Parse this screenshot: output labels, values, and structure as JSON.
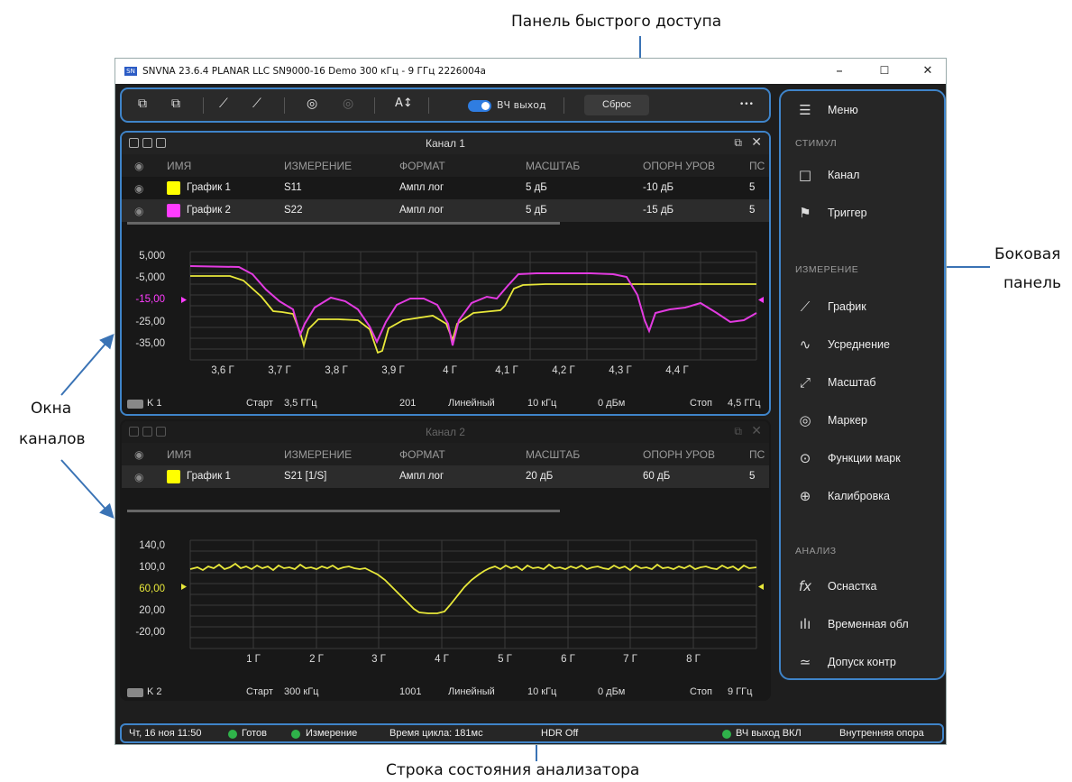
{
  "annotations": {
    "quick_panel": "Панель быстрого доступа",
    "side_panel_line1": "Боковая",
    "side_panel_line2": "панель",
    "channel_windows_line1": "Окна",
    "channel_windows_line2": "каналов",
    "status_bar": "Строка состояния анализатора"
  },
  "window": {
    "logo": "SN",
    "title": "SNVNA 23.6.4  PLANAR LLC SN9000-16 Demo 300 кГц - 9 ГГц 2226004a",
    "minimize": "–",
    "maximize": "☐",
    "close": "✕"
  },
  "quick_panel": {
    "rf_output_label": "ВЧ выход",
    "reset_label": "Сброс",
    "more": "•••",
    "autoscale": "A↕"
  },
  "channel1": {
    "title": "Канал 1",
    "headers": [
      "ИМЯ",
      "ИЗМЕРЕНИЕ",
      "ФОРМАТ",
      "МАСШТАБ",
      "ОПОРН УРОВ",
      "ПС"
    ],
    "rows": [
      {
        "name": "График 1",
        "meas": "S11",
        "format": "Ампл лог",
        "scale": "5 дБ",
        "ref": "-10 дБ",
        "pos": "5",
        "color": "#ffff00"
      },
      {
        "name": "График 2",
        "meas": "S22",
        "format": "Ампл лог",
        "scale": "5 дБ",
        "ref": "-15 дБ",
        "pos": "5",
        "color": "#ff3cff"
      }
    ],
    "y_ticks": [
      "5,000",
      "-5,000",
      "-15,00",
      "-25,00",
      "-35,00"
    ],
    "x_ticks": [
      "3,6 Г",
      "3,7 Г",
      "3,8 Г",
      "3,9 Г",
      "4 Г",
      "4,1 Г",
      "4,2 Г",
      "4,3 Г",
      "4,4 Г"
    ],
    "status": {
      "k": "K 1",
      "start_label": "Старт",
      "start": "3,5 ГГц",
      "points": "201",
      "sweep": "Линейный",
      "ifbw": "10 кГц",
      "power": "0 дБм",
      "stop_label": "Стоп",
      "stop": "4,5 ГГц"
    }
  },
  "channel2": {
    "title": "Канал 2",
    "headers": [
      "ИМЯ",
      "ИЗМЕРЕНИЕ",
      "ФОРМАТ",
      "МАСШТАБ",
      "ОПОРН УРОВ",
      "ПС"
    ],
    "rows": [
      {
        "name": "График 1",
        "meas": "S21 [1/S]",
        "format": "Ампл лог",
        "scale": "20 дБ",
        "ref": "60 дБ",
        "pos": "5",
        "color": "#ffff00"
      }
    ],
    "y_ticks": [
      "140,0",
      "100,0",
      "60,00",
      "20,00",
      "-20,00"
    ],
    "x_ticks": [
      "1 Г",
      "2 Г",
      "3 Г",
      "4 Г",
      "5 Г",
      "6 Г",
      "7 Г",
      "8 Г"
    ],
    "status": {
      "k": "K 2",
      "start_label": "Старт",
      "start": "300 кГц",
      "points": "1001",
      "sweep": "Линейный",
      "ifbw": "10 кГц",
      "power": "0 дБм",
      "stop_label": "Стоп",
      "stop": "9 ГГц"
    }
  },
  "side_panel": {
    "menu": "Меню",
    "sections": [
      {
        "title": "СТИМУЛ",
        "items": [
          {
            "label": "Канал",
            "icon": "□"
          },
          {
            "label": "Триггер",
            "icon": "⚑"
          }
        ]
      },
      {
        "title": "ИЗМЕРЕНИЕ",
        "items": [
          {
            "label": "График",
            "icon": "📈"
          },
          {
            "label": "Усреднение",
            "icon": "∿"
          },
          {
            "label": "Масштаб",
            "icon": "⤢"
          },
          {
            "label": "Маркер",
            "icon": "◎"
          },
          {
            "label": "Функции марк",
            "icon": "⊙"
          },
          {
            "label": "Калибровка",
            "icon": "⊕"
          }
        ]
      },
      {
        "title": "АНАЛИЗ",
        "items": [
          {
            "label": "Оснастка",
            "icon": "fx"
          },
          {
            "label": "Временная обл",
            "icon": "ılı"
          },
          {
            "label": "Допуск контр",
            "icon": "≃"
          }
        ]
      }
    ]
  },
  "status_bar": {
    "datetime": "Чт, 16 ноя 11:50",
    "ready": "Готов",
    "measuring": "Измерение",
    "cycle": "Время цикла: 181мс",
    "hdr": "HDR Off",
    "rf_on": "ВЧ выход ВКЛ",
    "ref": "Внутренняя опора"
  }
}
